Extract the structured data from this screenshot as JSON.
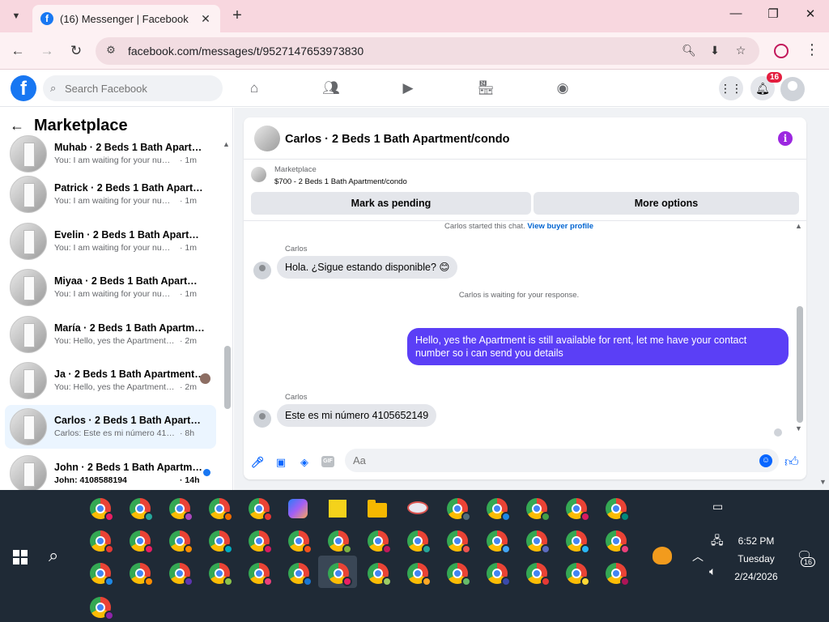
{
  "browser": {
    "tab_title": "(16) Messenger | Facebook",
    "url": "facebook.com/messages/t/9527147653973830"
  },
  "fb": {
    "search_placeholder": "Search Facebook",
    "notification_count": "16",
    "brand_color": "#1877f2"
  },
  "sidebar": {
    "title": "Marketplace",
    "conversations": [
      {
        "name": "Muhab · 2 Beds 1 Bath Apartme...",
        "preview": "You: I am waiting for your number...",
        "time": "· 1m"
      },
      {
        "name": "Patrick · 2 Beds 1 Bath Apartme...",
        "preview": "You: I am waiting for your number...",
        "time": "· 1m"
      },
      {
        "name": "Evelin · 2 Beds 1 Bath Apartmen...",
        "preview": "You: I am waiting for your number...",
        "time": "· 1m"
      },
      {
        "name": "Miyaa · 2 Beds 1 Bath Apartmen...",
        "preview": "You: I am waiting for your number...",
        "time": "· 1m"
      },
      {
        "name": "María · 2 Beds 1 Bath Apartmen...",
        "preview": "You: Hello, yes the Apartment is st...",
        "time": "· 2m"
      },
      {
        "name": "Ja · 2 Beds 1 Bath Apartment/...",
        "preview": "You: Hello, yes the Apartment i...",
        "time": "· 2m"
      },
      {
        "name": "Carlos · 2 Beds 1 Bath Apartmen...",
        "preview": "Carlos: Este es mi número 410565...",
        "time": "· 8h"
      },
      {
        "name": "John · 2 Beds 1 Bath Apartme...",
        "preview": "John: 4108588194",
        "time": "· 14h"
      }
    ]
  },
  "chat": {
    "title": "Carlos · 2 Beds 1 Bath Apartment/condo",
    "marketplace_label": "Marketplace",
    "listing": "$700 - 2 Beds 1 Bath Apartment/condo",
    "mark_pending": "Mark as pending",
    "more_options": "More options",
    "started_text": "Carlos started this chat.",
    "view_profile": "View buyer profile",
    "sender": "Carlos",
    "msg1": "Hola. ¿Sigue estando disponible? 😊",
    "waiting": "Carlos is waiting for your response.",
    "msg_out": "Hello, yes the Apartment is still available for rent, let me have your contact number so i can send you details",
    "msg2": "Este es mi número 4105652149",
    "composer_placeholder": "Aa",
    "accent_color": "#5b3ff6"
  },
  "taskbar": {
    "time": "6:52 PM",
    "day": "Tuesday",
    "date": "2/24/2026",
    "notif_count": "16"
  }
}
